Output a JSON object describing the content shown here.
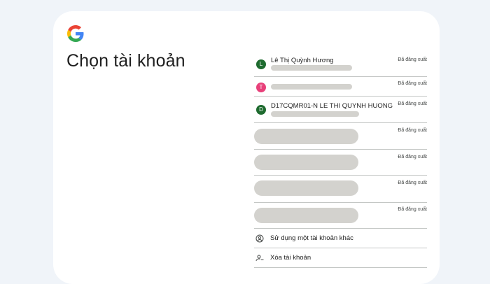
{
  "page": {
    "title": "Chọn tài khoản"
  },
  "accounts": [
    {
      "initial": "L",
      "avatar_color": "#1e6b2f",
      "name": "Lê Thị Quỳnh Hương",
      "status": "Đã đăng xuất"
    },
    {
      "initial": "T",
      "avatar_color": "#e8407a",
      "name": "",
      "status": "Đã đăng xuất"
    },
    {
      "initial": "D",
      "avatar_color": "#1e6b2f",
      "name": "D17CQMR01-N LE THI QUYNH HUONG",
      "status": "Đã đăng xuất"
    },
    {
      "initial": "",
      "avatar_color": "",
      "name": "",
      "status": "Đã đăng xuất"
    },
    {
      "initial": "",
      "avatar_color": "",
      "name": "",
      "status": "Đã đăng xuất"
    },
    {
      "initial": "",
      "avatar_color": "",
      "name": "",
      "status": "Đã đăng xuất"
    },
    {
      "initial": "",
      "avatar_color": "",
      "name": "",
      "status": "Đã đăng xuất"
    }
  ],
  "actions": {
    "use_another": {
      "label": "Sử dụng một tài khoản khác",
      "icon": "account-circle-icon"
    },
    "remove": {
      "label": "Xóa tài khoản",
      "icon": "person-remove-icon"
    }
  },
  "colors": {
    "background": "#f0f4f9",
    "card": "#ffffff",
    "divider": "#c4c7c5",
    "redacted": "#d3d2ce"
  }
}
